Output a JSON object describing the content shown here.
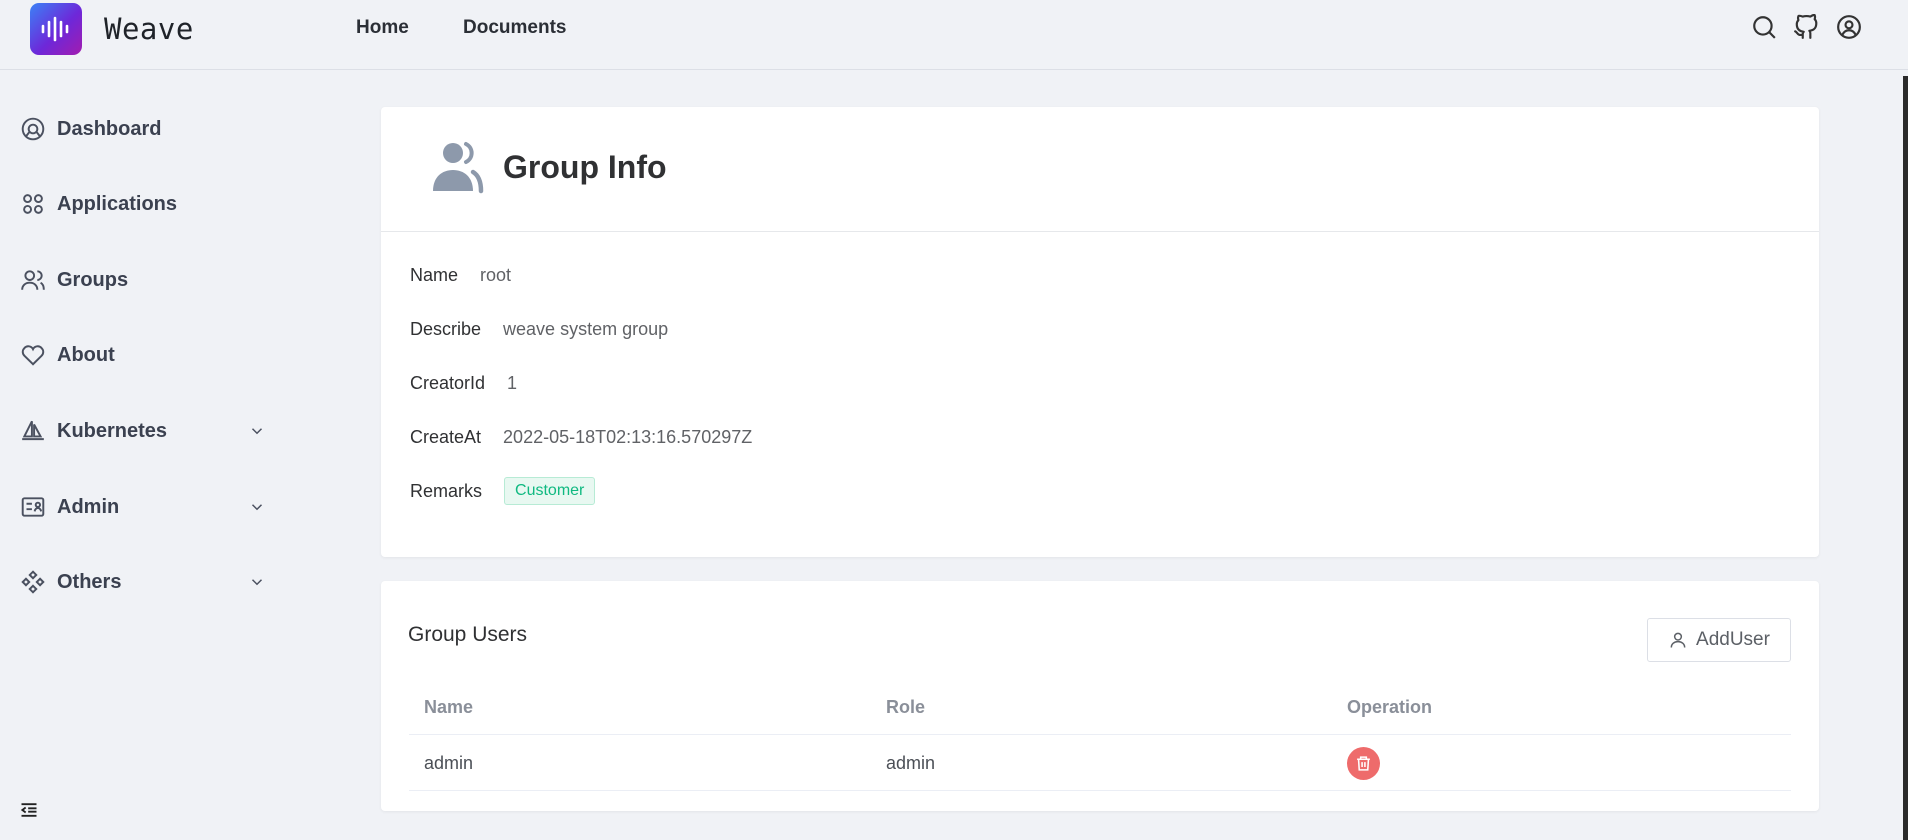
{
  "app": {
    "name": "Weave"
  },
  "topnav": [
    {
      "label": "Home"
    },
    {
      "label": "Documents"
    }
  ],
  "header_icons": [
    "search-icon",
    "github-icon",
    "user-circle-icon"
  ],
  "sidebar": {
    "items": [
      {
        "label": "Dashboard",
        "icon": "dashboard-icon"
      },
      {
        "label": "Applications",
        "icon": "applications-icon"
      },
      {
        "label": "Groups",
        "icon": "groups-icon"
      },
      {
        "label": "About",
        "icon": "heart-icon"
      },
      {
        "label": "Kubernetes",
        "icon": "sailboat-icon",
        "expandable": true
      },
      {
        "label": "Admin",
        "icon": "admin-icon",
        "expandable": true
      },
      {
        "label": "Others",
        "icon": "others-icon",
        "expandable": true
      }
    ]
  },
  "group_info": {
    "title": "Group Info",
    "fields": [
      {
        "key": "Name",
        "value": "root"
      },
      {
        "key": "Describe",
        "value": "weave system group"
      },
      {
        "key": "CreatorId",
        "value": "1"
      },
      {
        "key": "CreateAt",
        "value": "2022-05-18T02:13:16.570297Z"
      },
      {
        "key": "Remarks",
        "value": "Customer"
      }
    ]
  },
  "group_users": {
    "title": "Group Users",
    "add_button": "AddUser",
    "columns": [
      "Name",
      "Role",
      "Operation"
    ],
    "rows": [
      {
        "name": "admin",
        "role": "admin"
      }
    ]
  },
  "colors": {
    "accent_gradient": [
      "#3b82f6",
      "#a21caf"
    ],
    "tag_green": "#10b981",
    "danger": "#ee6b6b"
  }
}
